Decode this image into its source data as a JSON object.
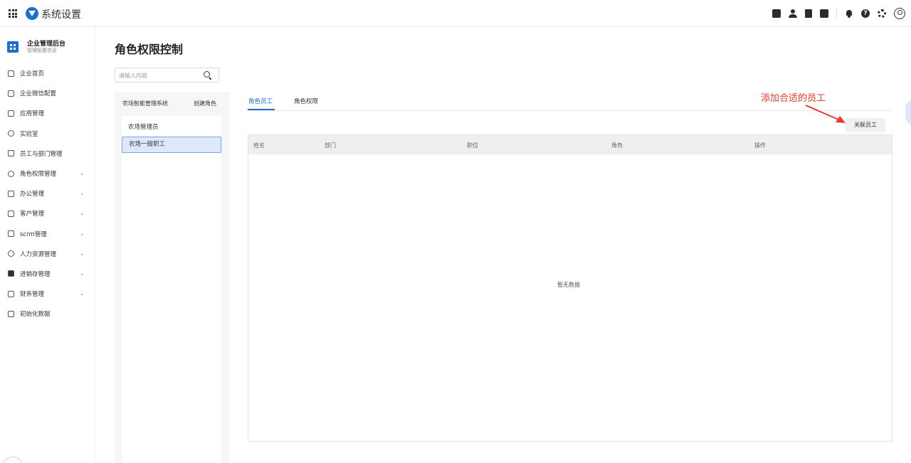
{
  "topbar": {
    "app_title": "系统设置",
    "icons": [
      "grid-icon",
      "brand-logo-icon",
      "task-icon",
      "contacts-icon",
      "document-icon",
      "phone-icon",
      "bell-icon",
      "help-icon",
      "settings-icon",
      "user-icon"
    ]
  },
  "sidebar": {
    "org_name": "企业管理后台",
    "org_sub": "管理配置信息",
    "items": [
      {
        "label": "企业首页",
        "icon": "home-icon",
        "expandable": false
      },
      {
        "label": "企业微信配置",
        "icon": "chat-icon",
        "expandable": false
      },
      {
        "label": "应用管理",
        "icon": "apps-icon",
        "expandable": false
      },
      {
        "label": "实验室",
        "icon": "lab-icon",
        "expandable": false
      },
      {
        "label": "员工与部门管理",
        "icon": "team-icon",
        "expandable": false
      },
      {
        "label": "角色权限管理",
        "icon": "role-icon",
        "expandable": true
      },
      {
        "label": "办公管理",
        "icon": "office-icon",
        "expandable": true
      },
      {
        "label": "客户管理",
        "icon": "customer-icon",
        "expandable": true
      },
      {
        "label": "scrm管理",
        "icon": "scrm-icon",
        "expandable": true
      },
      {
        "label": "人力资源管理",
        "icon": "hr-icon",
        "expandable": true
      },
      {
        "label": "进销存管理",
        "icon": "inventory-icon",
        "expandable": true
      },
      {
        "label": "财务管理",
        "icon": "finance-icon",
        "expandable": true
      },
      {
        "label": "初始化数据",
        "icon": "init-icon",
        "expandable": false
      }
    ]
  },
  "main": {
    "page_title": "角色权限控制",
    "search_placeholder": "请输入内容",
    "system_name": "农场智能管理系统",
    "create_role": "创建角色",
    "roles": [
      "农场管理员",
      "农场一般职工"
    ],
    "active_role": "农场一般职工",
    "tabs": [
      "角色员工",
      "角色权限"
    ],
    "active_tab": "角色员工",
    "annotation": "添加合适的员工",
    "link_button": "关联员工",
    "table_headers": [
      "姓名",
      "部门",
      "职位",
      "角色",
      "操作"
    ],
    "empty_text": "暂无数据",
    "colors": {
      "primary": "#1a6fd1",
      "annotation": "#e83a30"
    }
  }
}
